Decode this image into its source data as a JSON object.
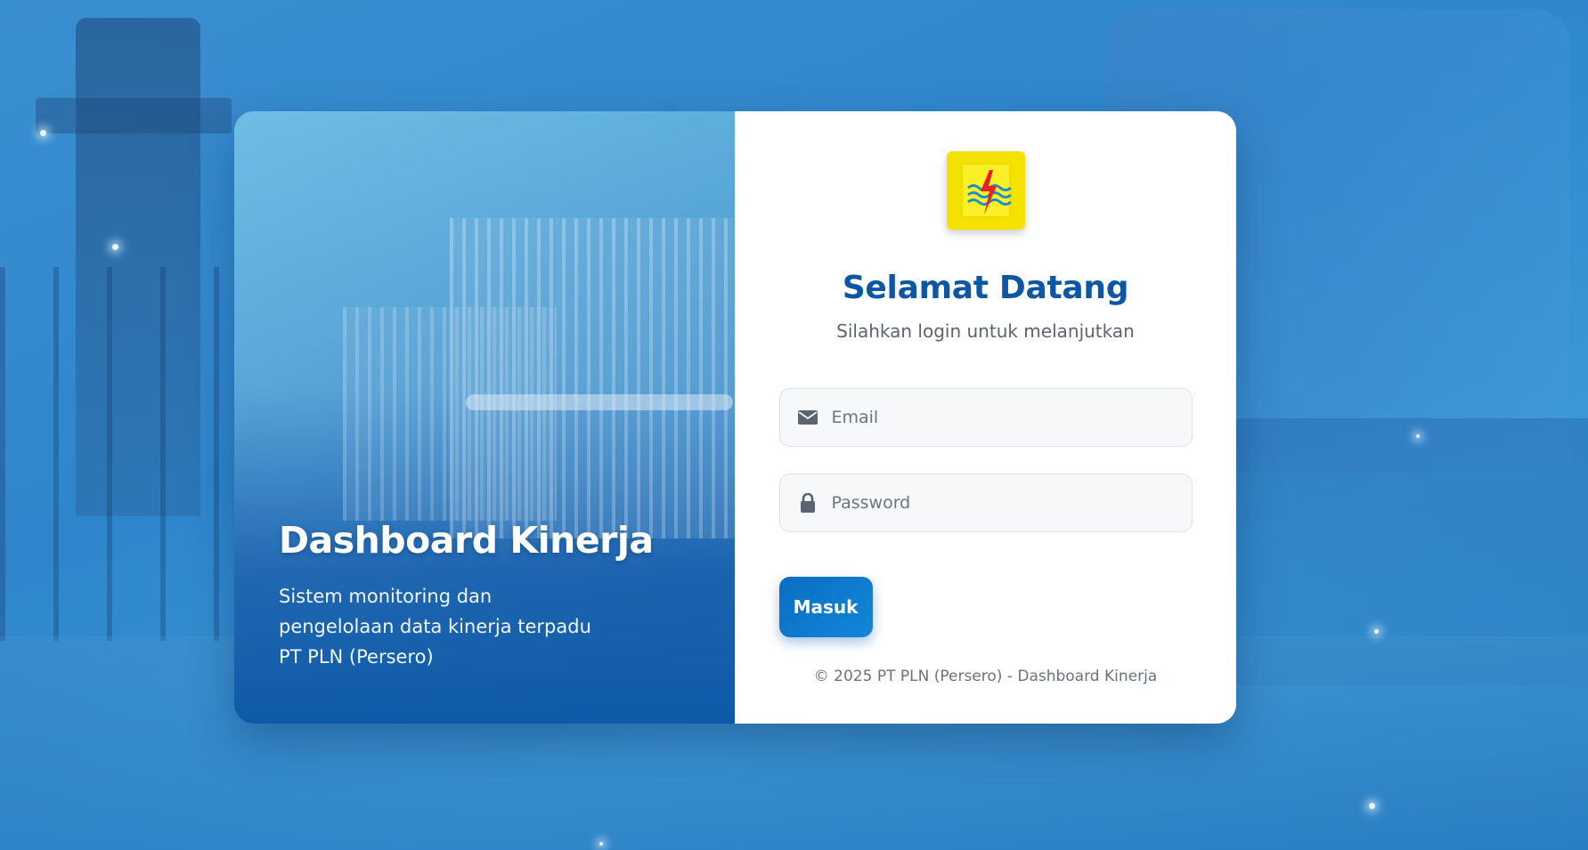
{
  "brand": {
    "logo_icon": "pln-lightning-logo-icon",
    "logo_color": "#f6e200",
    "primary_color": "#0b57a6"
  },
  "hero": {
    "title": "Dashboard Kinerja",
    "description": "Sistem monitoring dan pengelolaan data kinerja terpadu PT PLN (Persero)"
  },
  "login": {
    "title": "Selamat Datang",
    "subtitle": "Silahkan login untuk melanjutkan",
    "email": {
      "placeholder": "Email",
      "value": "",
      "icon": "envelope-icon"
    },
    "password": {
      "placeholder": "Password",
      "value": "",
      "icon": "lock-icon"
    },
    "submit_label": "Masuk",
    "footer": "© 2025 PT PLN (Persero) - Dashboard Kinerja"
  }
}
